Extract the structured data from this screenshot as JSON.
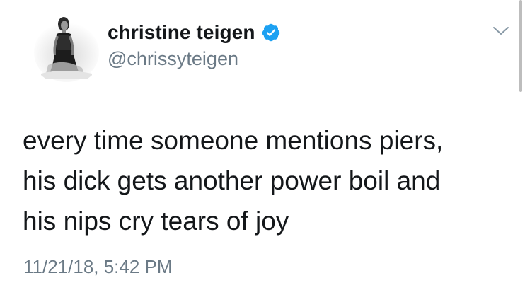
{
  "author": {
    "display_name": "christine teigen",
    "handle": "@chrissyteigen",
    "verified": true,
    "avatar_icon": "profile-photo-icon"
  },
  "tweet": {
    "text": "every time someone mentions piers,\nhis dick gets another power boil and\nhis nips cry tears of joy",
    "timestamp": "11/21/18, 5:42 PM"
  },
  "icons": {
    "verified": "verified-badge-icon",
    "menu": "chevron-down-icon"
  },
  "colors": {
    "verified_badge": "#1da1f2",
    "secondary_text": "#6b7a86",
    "primary_text": "#14171a"
  }
}
